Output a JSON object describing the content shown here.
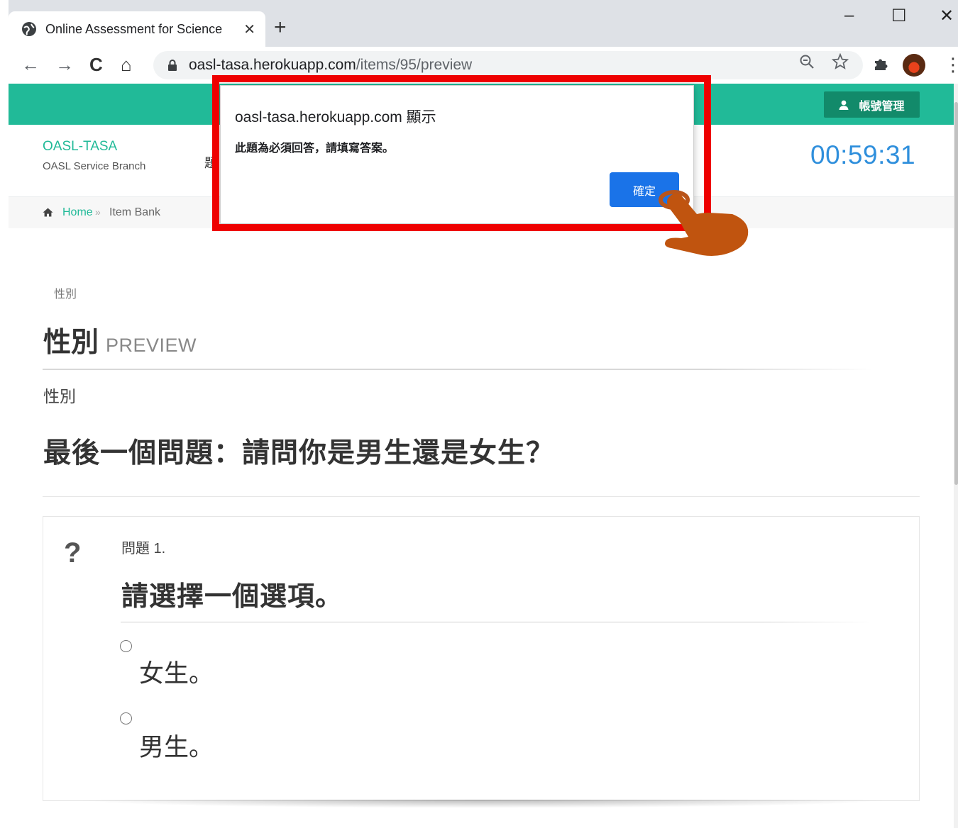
{
  "browser": {
    "tab_title": "Online Assessment for Science",
    "tab_close": "✕",
    "new_tab": "+",
    "window_controls": {
      "minimize": "–",
      "maximize": "☐",
      "close": "✕"
    },
    "nav": {
      "back": "←",
      "forward": "→",
      "reload": "C",
      "home": "⌂"
    },
    "url_host": "oasl-tasa.herokuapp.com",
    "url_path": "/items/95/preview",
    "icons": [
      "globe-icon",
      "lock-icon",
      "zoom-icon",
      "star-icon",
      "puzzle-icon",
      "kebab-icon"
    ]
  },
  "topbar": {
    "account_label": "帳號管理",
    "accent_color": "#21ba98"
  },
  "header": {
    "brand_name": "OASL-TASA",
    "brand_sub": "OASL Service Branch",
    "partial_text": "題",
    "timer": "00:59:31"
  },
  "breadcrumb": {
    "home": "Home",
    "separator": "»",
    "current": "Item Bank"
  },
  "main": {
    "small_label": "性別",
    "title": "性別",
    "title_suffix": "PREVIEW",
    "subtitle": "性別",
    "question_heading": "最後一個問題：請問你是男生還是女生？"
  },
  "question": {
    "mark": "?",
    "number": "問題 1.",
    "prompt": "請選擇一個選項。",
    "options": [
      {
        "label": "女生。"
      },
      {
        "label": "男生。"
      }
    ]
  },
  "dialog": {
    "title": "oasl-tasa.herokuapp.com 顯示",
    "message": "此題為必須回答，請填寫答案。",
    "ok_label": "確定",
    "highlight_color": "#ee0000"
  }
}
